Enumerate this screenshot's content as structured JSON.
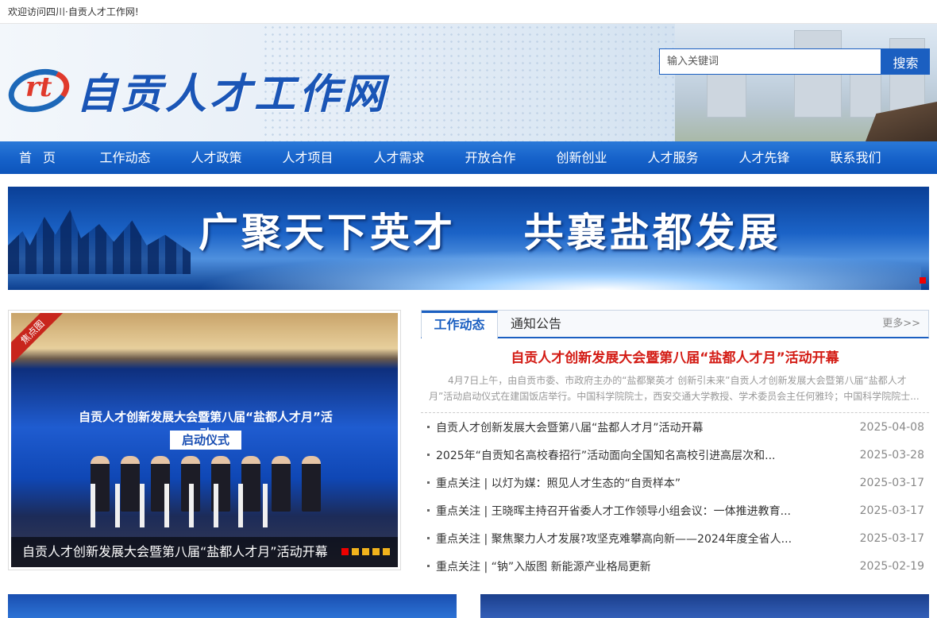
{
  "topbar": {
    "welcome": "欢迎访问四川·自贡人才工作网!"
  },
  "header": {
    "logo_letters": "rt",
    "site_name": "自贡人才工作网",
    "search": {
      "placeholder": "输入关键词",
      "value": "",
      "button": "搜索"
    }
  },
  "nav": {
    "items": [
      "首页",
      "工作动态",
      "人才政策",
      "人才项目",
      "人才需求",
      "开放合作",
      "创新创业",
      "人才服务",
      "人才先锋",
      "联系我们"
    ]
  },
  "banner": {
    "slogan": "广聚天下英才    共襄盐都发展"
  },
  "focus": {
    "ribbon": "焦点图",
    "stage_title": "自贡人才创新发展大会暨第八届“盐都人才月”活动",
    "stage_subtitle": "启动仪式",
    "caption": "自贡人才创新发展大会暨第八届“盐都人才月”活动开幕",
    "pager_count": 5,
    "pager_active": 0
  },
  "news": {
    "tabs": [
      "工作动态",
      "通知公告"
    ],
    "active_tab": 0,
    "more": "更多>>",
    "headline": "自贡人才创新发展大会暨第八届“盐都人才月”活动开幕",
    "summary": "4月7日上午，由自贡市委、市政府主办的“盐都聚英才 创新引未来”自贡人才创新发展大会暨第八届“盐都人才月”活动启动仪式在建国饭店举行。中国科学院院士，西安交通大学教授、学术委员会主任何雅玲；中国科学院院士...",
    "items": [
      {
        "title": "自贡人才创新发展大会暨第八届“盐都人才月”活动开幕",
        "date": "2025-04-08"
      },
      {
        "title": "2025年“自贡知名高校春招行”活动面向全国知名高校引进高层次和...",
        "date": "2025-03-28"
      },
      {
        "title": "重点关注 | 以灯为媒：照见人才生态的“自贡样本”",
        "date": "2025-03-17"
      },
      {
        "title": "重点关注 | 王晓晖主持召开省委人才工作领导小组会议：一体推进教育...",
        "date": "2025-03-17"
      },
      {
        "title": "重点关注 | 聚焦聚力人才发展?攻坚克难攀高向新——2024年度全省人...",
        "date": "2025-03-17"
      },
      {
        "title": "重点关注 | “钠”入版图 新能源产业格局更新",
        "date": "2025-02-19"
      }
    ]
  },
  "colors": {
    "brand_blue": "#1b5fc1",
    "headline_red": "#d31b14"
  }
}
